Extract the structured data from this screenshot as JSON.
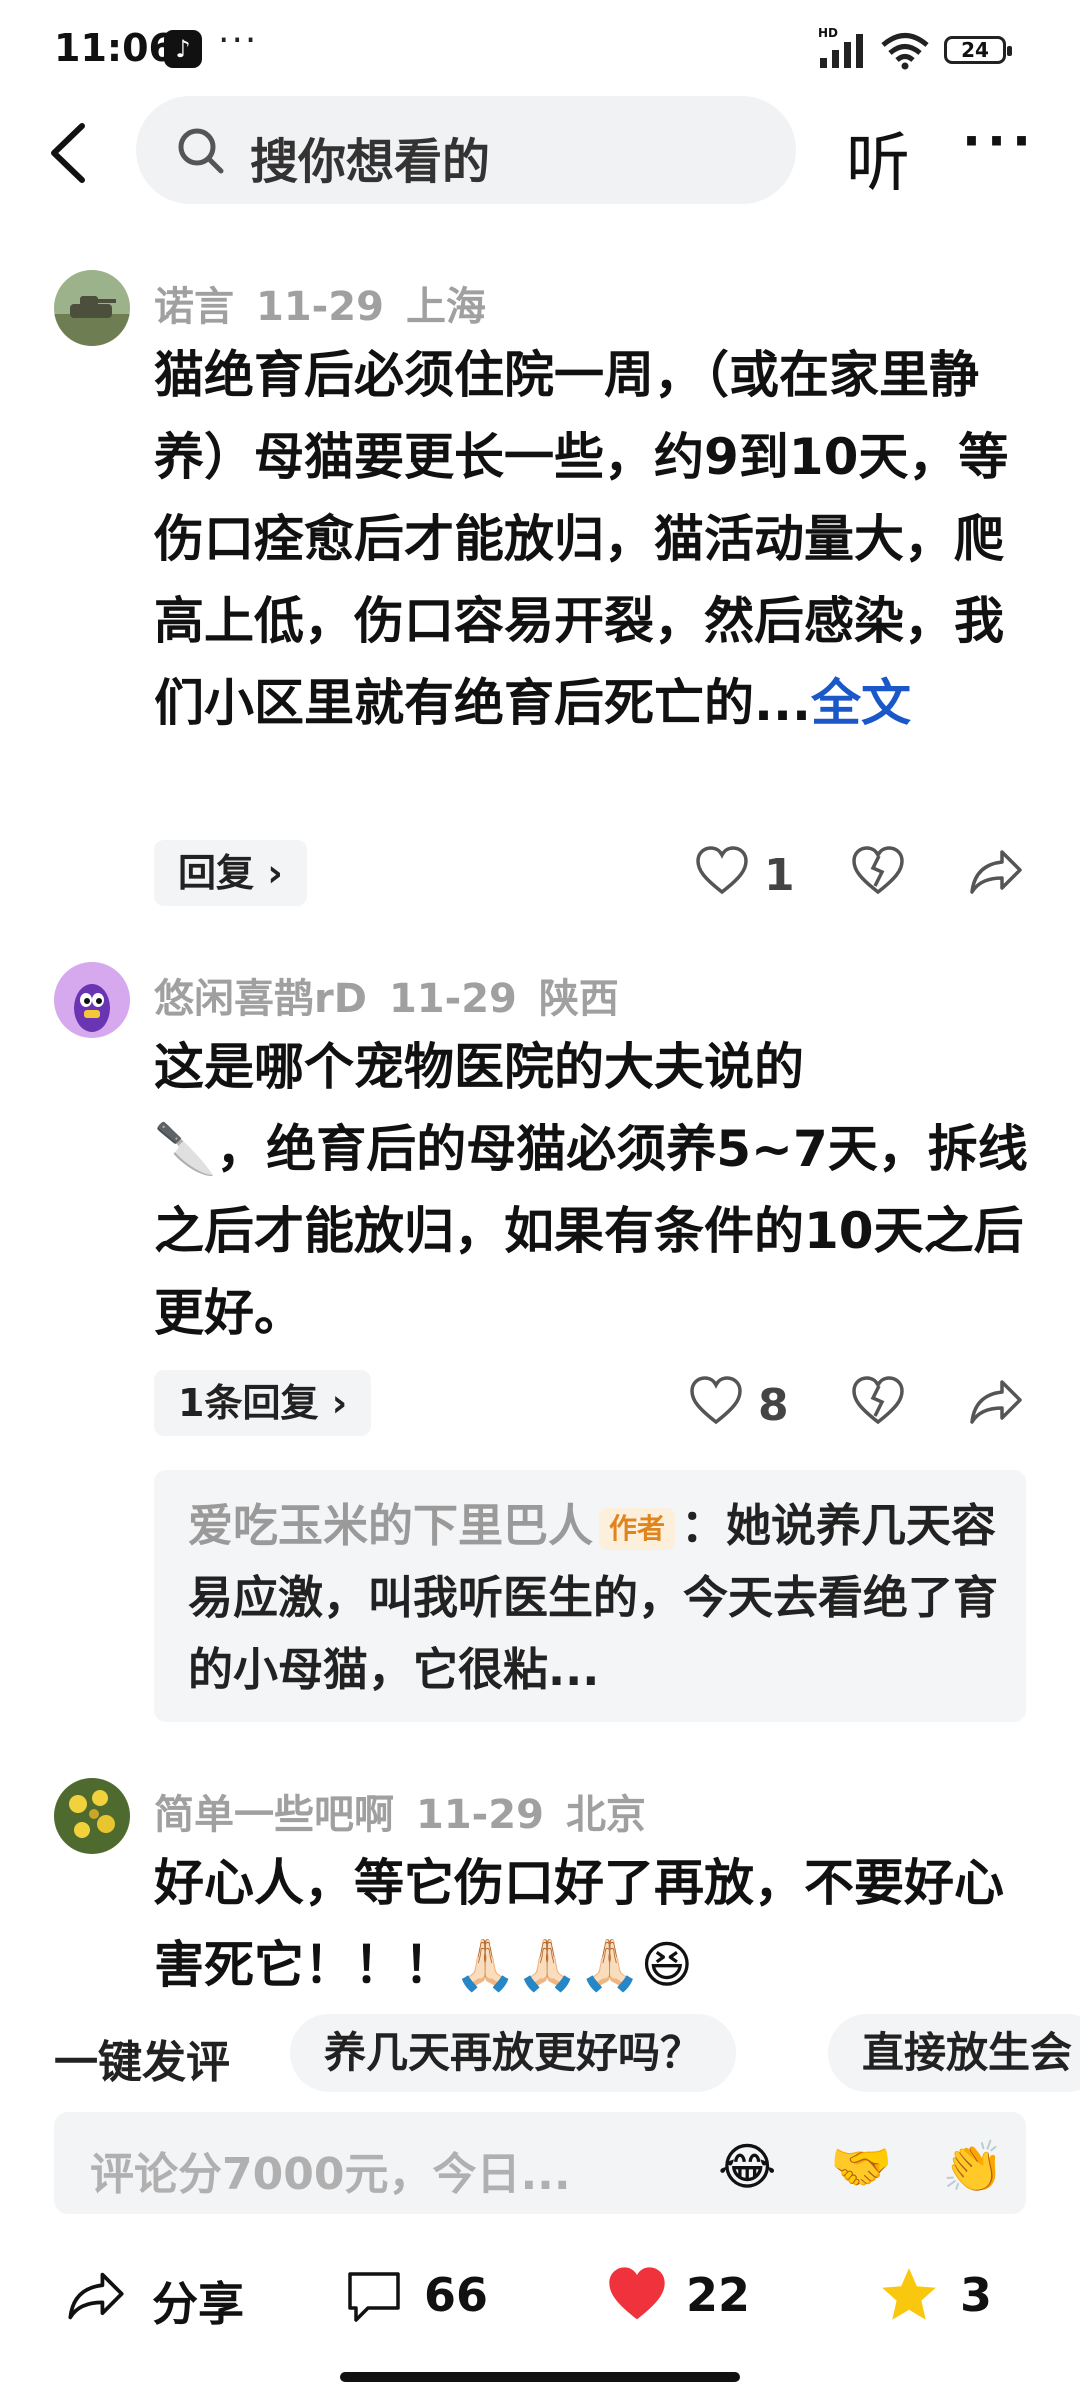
{
  "status_bar": {
    "time": "11:06",
    "app_badge": "♪",
    "more": "···",
    "network": "HD",
    "battery": "24"
  },
  "header": {
    "search_placeholder": "搜你想看的",
    "listen_label": "听",
    "more_label": "···"
  },
  "comments": [
    {
      "user": "诺言",
      "date": "11-29",
      "location": "上海",
      "text": "猫绝育后必须住院一周，（或在家里静养）母猫要更长一些，约9到10天，等伤口痊愈后才能放归，猫活动量大，爬高上低，伤口容易开裂，然后感染，我们小区里就有绝育后死亡的...",
      "full_link": "全文",
      "reply_label": "回复 ›",
      "likes": "1"
    },
    {
      "user": "悠闲喜鹊rD",
      "date": "11-29",
      "location": "陕西",
      "text_line1": "这是哪个宠物医院的大夫说的",
      "text_rest": "，绝育后的母猫必须养5~7天，拆线之后才能放归，如果有条件的10天之后更好。",
      "emoji": "🔪",
      "reply_label": "1条回复 ›",
      "likes": "8",
      "subreply": {
        "author": "爱吃玉米的下里巴人",
        "tag": "作者",
        "text": "：她说养几天容易应激，叫我听医生的，今天去看绝了育的小母猫，它很粘..."
      }
    },
    {
      "user": "简单一些吧啊",
      "date": "11-29",
      "location": "北京",
      "text": "好心人，等它伤口好了再放，不要好心害死它！！！",
      "emoji": "🙏🏻🙏🏻🙏🏻😆"
    }
  ],
  "quick_comment": {
    "label": "一键发评",
    "chips": [
      "养几天再放更好吗？",
      "直接放生会"
    ]
  },
  "input": {
    "placeholder": "评论分7000元，今日...",
    "emojis": [
      "😂",
      "🤝",
      "👏"
    ]
  },
  "bottom_bar": {
    "share_label": "分享",
    "comments_count": "66",
    "likes_count": "22",
    "favorites_count": "3"
  },
  "colors": {
    "link": "#1a57c8",
    "like_red": "#f0323c",
    "star_yellow": "#f9c80e"
  }
}
